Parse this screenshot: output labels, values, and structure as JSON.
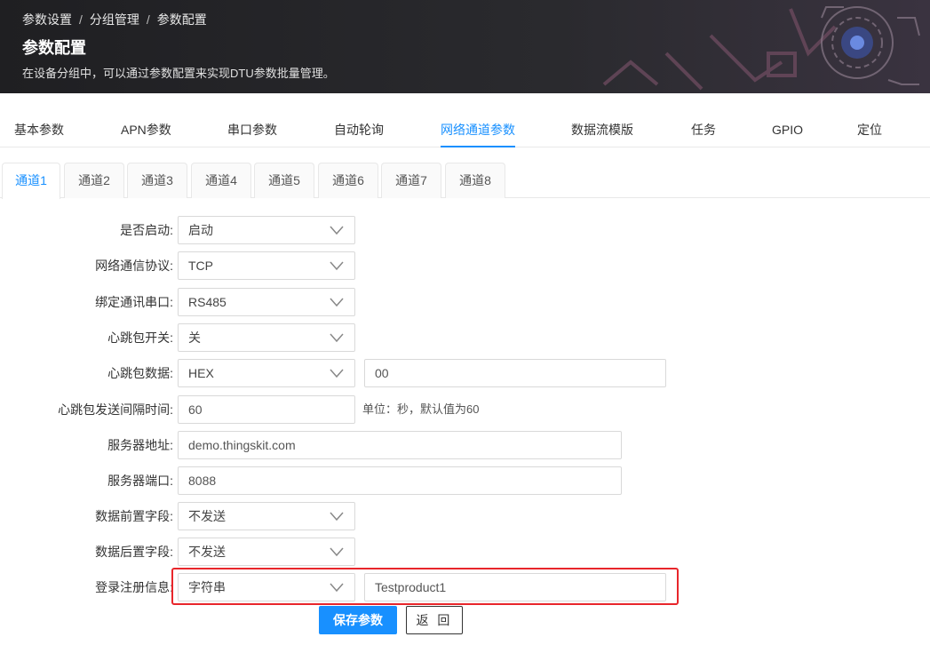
{
  "header": {
    "breadcrumb": [
      "参数设置",
      "分组管理",
      "参数配置"
    ],
    "breadcrumb_sep": "/",
    "title": "参数配置",
    "description": "在设备分组中，可以通过参数配置来实现DTU参数批量管理。"
  },
  "main_tabs": [
    {
      "label": "基本参数"
    },
    {
      "label": "APN参数"
    },
    {
      "label": "串口参数"
    },
    {
      "label": "自动轮询"
    },
    {
      "label": "网络通道参数",
      "active": true
    },
    {
      "label": "数据流模版"
    },
    {
      "label": "任务"
    },
    {
      "label": "GPIO"
    },
    {
      "label": "定位"
    }
  ],
  "channel_tabs": [
    {
      "label": "通道1",
      "active": true
    },
    {
      "label": "通道2"
    },
    {
      "label": "通道3"
    },
    {
      "label": "通道4"
    },
    {
      "label": "通道5"
    },
    {
      "label": "通道6"
    },
    {
      "label": "通道7"
    },
    {
      "label": "通道8"
    }
  ],
  "form": {
    "enabled": {
      "label": "是否启动:",
      "value": "启动"
    },
    "protocol": {
      "label": "网络通信协议:",
      "value": "TCP"
    },
    "serial": {
      "label": "绑定通讯串口:",
      "value": "RS485"
    },
    "heartbeat_switch": {
      "label": "心跳包开关:",
      "value": "关"
    },
    "heartbeat_data": {
      "label": "心跳包数据:",
      "format": "HEX",
      "value": "00"
    },
    "heartbeat_interval": {
      "label": "心跳包发送间隔时间:",
      "value": "60",
      "hint": "单位：秒，默认值为60"
    },
    "server_address": {
      "label": "服务器地址:",
      "value": "demo.thingskit.com"
    },
    "server_port": {
      "label": "服务器端口:",
      "value": "8088"
    },
    "data_prefix": {
      "label": "数据前置字段:",
      "value": "不发送"
    },
    "data_suffix": {
      "label": "数据后置字段:",
      "value": "不发送"
    },
    "login_info": {
      "label": "登录注册信息:",
      "format": "字符串",
      "value": "Testproduct1"
    }
  },
  "buttons": {
    "save": "保存参数",
    "back": "返 回"
  },
  "colors": {
    "accent": "#1890ff",
    "highlight": "#e8262b",
    "header_bg": "#1f1f22"
  }
}
